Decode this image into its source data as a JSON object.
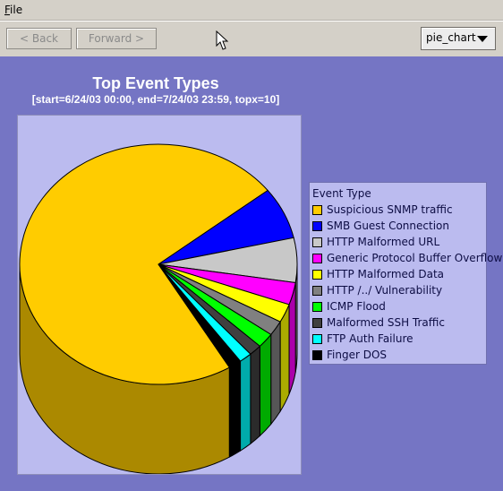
{
  "menu": {
    "file_prefix": "F",
    "file_rest": "ile"
  },
  "toolbar": {
    "back_label": "< Back",
    "forward_label": "Forward >",
    "chart_type_value": "pie_chart"
  },
  "colors": {
    "window": "#d4d0c8",
    "chart_background": "#7575c4",
    "panel_background": "#bbbbef"
  },
  "chart_data": {
    "type": "pie",
    "title": "Top Event Types",
    "subtitle": "[start=6/24/03 00:00, end=7/24/03 23:59, topx=10]",
    "legend_title": "Event Type",
    "legend_position": "right",
    "categories": [
      "Suspicious SNMP traffic",
      "SMB Guest Connection",
      "HTTP Malformed URL",
      "Generic Protocol Buffer Overflow",
      "HTTP Malformed Data",
      "HTTP /../ Vulnerability",
      "ICMP Flood",
      "Malformed SSH Traffic",
      "FTP Auth Failure",
      "Finger DOS"
    ],
    "values": [
      73.0,
      7.0,
      6.0,
      3.0,
      2.5,
      2.0,
      2.0,
      1.5,
      1.5,
      1.5
    ],
    "colors": [
      "#ffcc00",
      "#0000ff",
      "#c8c8c8",
      "#ff00ff",
      "#ffff00",
      "#808080",
      "#00ff00",
      "#404040",
      "#00ffff",
      "#000000"
    ]
  }
}
